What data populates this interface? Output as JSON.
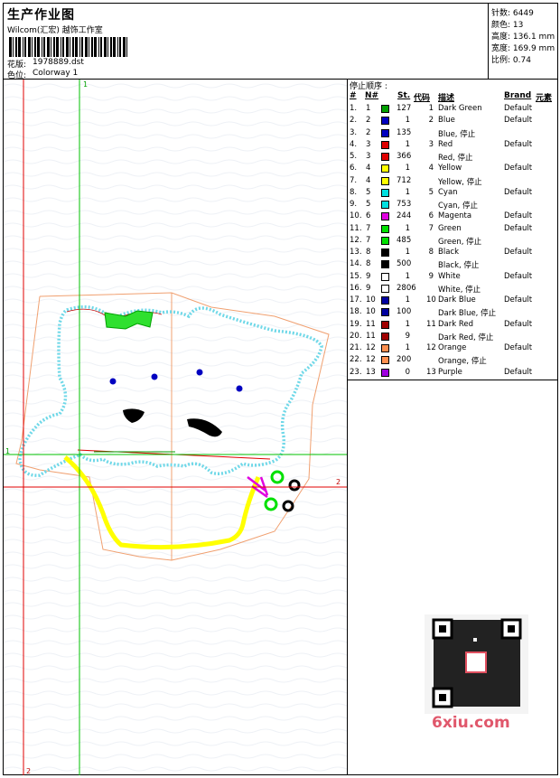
{
  "header": {
    "title": "生产作业图",
    "company": "Wilcom(汇宏) 越饰工作室",
    "design_label": "花版:",
    "design_value": "1978889.dst",
    "colorway_label": "色位:",
    "colorway_value": "Colorway 1"
  },
  "stats": [
    {
      "label": "针数:",
      "value": "6449"
    },
    {
      "label": "颜色:",
      "value": "13"
    },
    {
      "label": "高度:",
      "value": "136.1 mm"
    },
    {
      "label": "宽度:",
      "value": "169.9 mm"
    },
    {
      "label": "比例:",
      "value": "0.74"
    }
  ],
  "canvas_markers": {
    "x_top": "1",
    "y_left": "1",
    "x_right": "2",
    "y_bottom": "2"
  },
  "stop_table": {
    "title": "停止顺序 :",
    "headers": {
      "seq": "#",
      "no": "N#",
      "st": "St.",
      "code": "代码",
      "desc": "描述",
      "brand": "Brand",
      "element": "元素"
    },
    "rows": [
      {
        "seq": "1.",
        "no": "1",
        "color": "#00a000",
        "st": "127",
        "code": "1",
        "desc": "Dark Green",
        "brand": "Default"
      },
      {
        "seq": "2.",
        "no": "2",
        "color": "#0000c0",
        "st": "1",
        "code": "2",
        "desc": "Blue",
        "brand": "Default"
      },
      {
        "seq": "3.",
        "no": "2",
        "color": "#0000c0",
        "st": "135",
        "code": "",
        "desc": "Blue, 停止",
        "brand": ""
      },
      {
        "seq": "4.",
        "no": "3",
        "color": "#e00000",
        "st": "1",
        "code": "3",
        "desc": "Red",
        "brand": "Default"
      },
      {
        "seq": "5.",
        "no": "3",
        "color": "#e00000",
        "st": "366",
        "code": "",
        "desc": "Red, 停止",
        "brand": ""
      },
      {
        "seq": "6.",
        "no": "4",
        "color": "#ffff00",
        "st": "1",
        "code": "4",
        "desc": "Yellow",
        "brand": "Default"
      },
      {
        "seq": "7.",
        "no": "4",
        "color": "#ffff00",
        "st": "712",
        "code": "",
        "desc": "Yellow, 停止",
        "brand": ""
      },
      {
        "seq": "8.",
        "no": "5",
        "color": "#00e0e0",
        "st": "1",
        "code": "5",
        "desc": "Cyan",
        "brand": "Default"
      },
      {
        "seq": "9.",
        "no": "5",
        "color": "#00e0e0",
        "st": "753",
        "code": "",
        "desc": "Cyan, 停止",
        "brand": ""
      },
      {
        "seq": "10.",
        "no": "6",
        "color": "#e000e0",
        "st": "244",
        "code": "6",
        "desc": "Magenta",
        "brand": "Default"
      },
      {
        "seq": "11.",
        "no": "7",
        "color": "#00e000",
        "st": "1",
        "code": "7",
        "desc": "Green",
        "brand": "Default"
      },
      {
        "seq": "12.",
        "no": "7",
        "color": "#00e000",
        "st": "485",
        "code": "",
        "desc": "Green, 停止",
        "brand": ""
      },
      {
        "seq": "13.",
        "no": "8",
        "color": "#000000",
        "st": "1",
        "code": "8",
        "desc": "Black",
        "brand": "Default"
      },
      {
        "seq": "14.",
        "no": "8",
        "color": "#000000",
        "st": "500",
        "code": "",
        "desc": "Black, 停止",
        "brand": ""
      },
      {
        "seq": "15.",
        "no": "9",
        "color": "#ffffff",
        "st": "1",
        "code": "9",
        "desc": "White",
        "brand": "Default"
      },
      {
        "seq": "16.",
        "no": "9",
        "color": "#ffffff",
        "st": "2806",
        "code": "",
        "desc": "White, 停止",
        "brand": ""
      },
      {
        "seq": "17.",
        "no": "10",
        "color": "#0000a0",
        "st": "1",
        "code": "10",
        "desc": "Dark Blue",
        "brand": "Default"
      },
      {
        "seq": "18.",
        "no": "10",
        "color": "#0000a0",
        "st": "100",
        "code": "",
        "desc": "Dark Blue, 停止",
        "brand": ""
      },
      {
        "seq": "19.",
        "no": "11",
        "color": "#a00000",
        "st": "1",
        "code": "11",
        "desc": "Dark Red",
        "brand": "Default"
      },
      {
        "seq": "20.",
        "no": "11",
        "color": "#a00000",
        "st": "9",
        "code": "",
        "desc": "Dark Red, 停止",
        "brand": ""
      },
      {
        "seq": "21.",
        "no": "12",
        "color": "#ff9050",
        "st": "1",
        "code": "12",
        "desc": "Orange",
        "brand": "Default"
      },
      {
        "seq": "22.",
        "no": "12",
        "color": "#ff9050",
        "st": "200",
        "code": "",
        "desc": "Orange, 停止",
        "brand": ""
      },
      {
        "seq": "23.",
        "no": "13",
        "color": "#a000e0",
        "st": "0",
        "code": "13",
        "desc": "Purple",
        "brand": "Default"
      }
    ]
  },
  "watermark": "6xiu.com"
}
